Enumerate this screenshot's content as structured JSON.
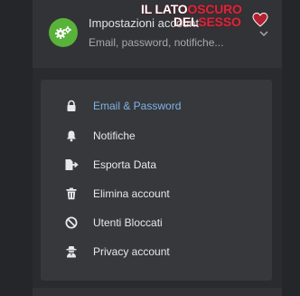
{
  "header": {
    "title": "Impostazioni account",
    "subtitle": "Email, password, notifiche...",
    "avatar_icon": "gears-icon",
    "expand_icon": "chevron-down-icon",
    "accent": "#59b33a"
  },
  "watermark": {
    "line1_white": "IL LATO",
    "line1_red": "OSCURO",
    "line2_white": "DEL",
    "line2_red": "SESSO"
  },
  "menu": {
    "active_color": "#7fb3e6",
    "items": [
      {
        "label": "Email & Password",
        "icon": "lock-icon",
        "active": true
      },
      {
        "label": "Notifiche",
        "icon": "bell-icon",
        "active": false
      },
      {
        "label": "Esporta Data",
        "icon": "export-file-icon",
        "active": false
      },
      {
        "label": "Elimina account",
        "icon": "trash-icon",
        "active": false
      },
      {
        "label": "Utenti Bloccati",
        "icon": "block-icon",
        "active": false
      },
      {
        "label": "Privacy account",
        "icon": "user-secret-icon",
        "active": false
      }
    ]
  }
}
